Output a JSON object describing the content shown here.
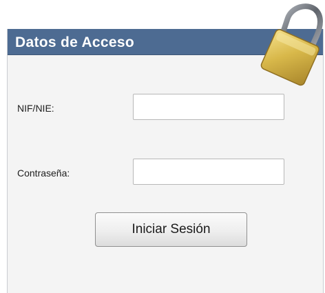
{
  "panel": {
    "title": "Datos de Acceso"
  },
  "icons": {
    "lock": "padlock-icon"
  },
  "colors": {
    "header": "#4d6b92",
    "panel_background": "#f4f4f4",
    "lock_gold": "#d8b84a"
  },
  "form": {
    "nif_label": "NIF/NIE:",
    "nif_value": "",
    "password_label": "Contraseña:",
    "password_value": "",
    "submit_label": "Iniciar Sesión"
  }
}
